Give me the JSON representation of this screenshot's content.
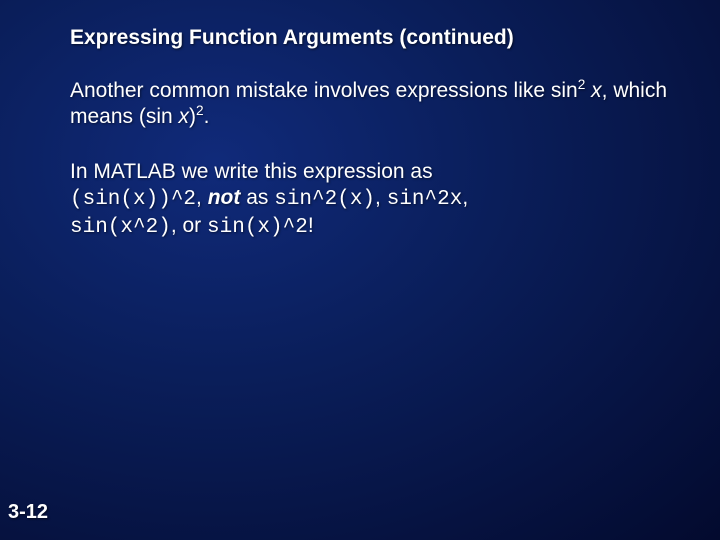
{
  "slide": {
    "title": "Expressing Function Arguments (continued)",
    "para1": {
      "pre": "Another common mistake involves expressions like sin",
      "sup1": "2",
      "mid": " ",
      "x1": "x",
      "after1": ", which means (sin ",
      "x2": "x",
      "close": ")",
      "sup2": "2",
      "period": "."
    },
    "para2": {
      "line1": "In MATLAB we write this expression as",
      "code1": "(sin(x))^2",
      "sep1": ", ",
      "not": "not",
      "sep2": " as ",
      "code2": "sin^2(x)",
      "sep3": ", ",
      "code3": "sin^2x",
      "sep4": ",",
      "code4": "sin(x^2)",
      "sep5": ", or ",
      "code5": "sin(x)^2",
      "end": "!"
    },
    "pageNumber": "3-12"
  }
}
